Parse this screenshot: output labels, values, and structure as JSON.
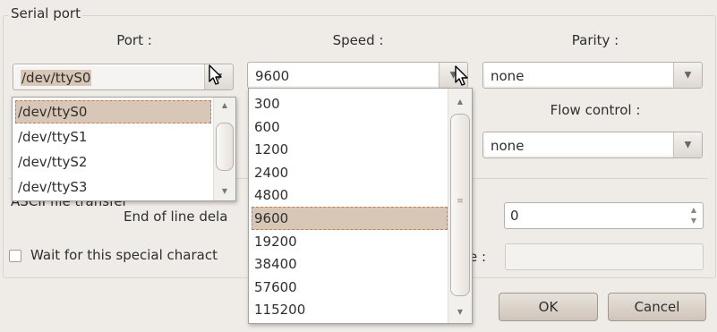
{
  "serial_port": {
    "title": "Serial port",
    "port_label": "Port :",
    "speed_label": "Speed :",
    "parity_label": "Parity :",
    "flow_label": "Flow control :",
    "port_value": "/dev/ttyS0",
    "speed_value": "9600",
    "parity_value": "none",
    "flow_value": "none"
  },
  "ascii": {
    "title": "ASCII file transfer",
    "eol_label": "End of line dela",
    "eol_value": "0",
    "wait_label": "Wait for this special charact",
    "wait_suffix": "e :"
  },
  "port_options": [
    "/dev/ttyS0",
    "/dev/ttyS1",
    "/dev/ttyS2",
    "/dev/ttyS3"
  ],
  "port_selected_index": 0,
  "speed_options": [
    "300",
    "600",
    "1200",
    "2400",
    "4800",
    "9600",
    "19200",
    "38400",
    "57600",
    "115200"
  ],
  "speed_selected_index": 5,
  "buttons": {
    "ok": "OK",
    "cancel": "Cancel"
  },
  "icons": {
    "combo_arrow": "triangle-down-icon",
    "scroll_up": "triangle-up-icon",
    "scroll_down": "triangle-down-icon",
    "pointer": "mouse-pointer-icon"
  },
  "colors": {
    "window_bg": "#efebe7",
    "selection_bg": "#d8c7b6",
    "selection_outline": "#c47e55",
    "button_bg": "#d9d0c7"
  }
}
